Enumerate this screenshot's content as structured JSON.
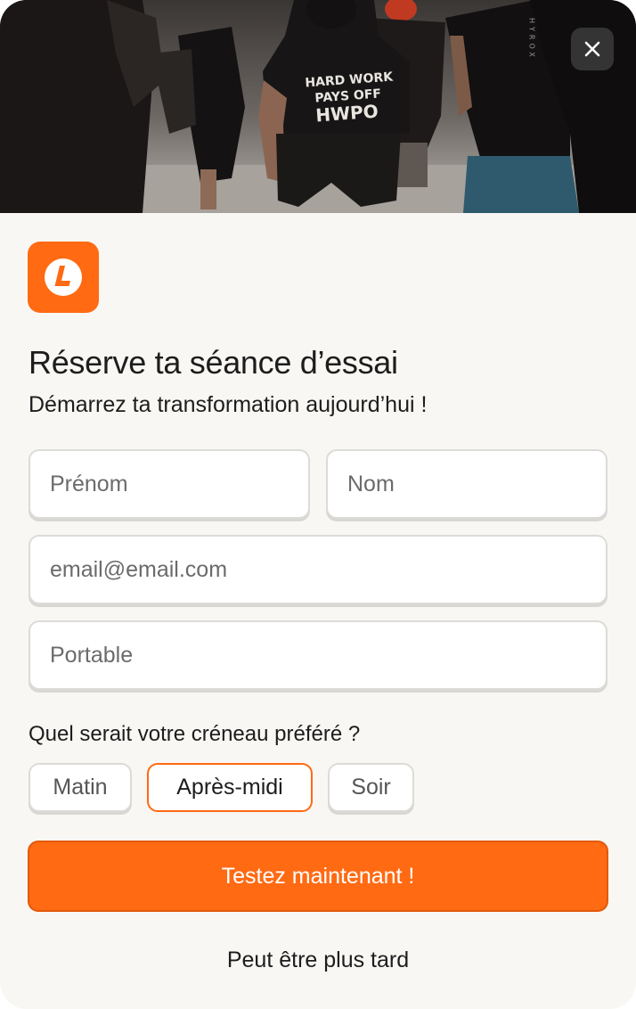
{
  "hero": {
    "photo_icon": "runners-photo",
    "shirt_text": [
      "HARD WORK",
      "PAYS OFF",
      "HWPO"
    ],
    "banner_text": "HYROX"
  },
  "close": {
    "icon": "close-icon"
  },
  "logo": {
    "icon": "brand-logo-icon",
    "color": "#ff6a13"
  },
  "title": "Réserve ta séance d’essai",
  "subtitle": "Démarrez ta transformation aujourd’hui !",
  "form": {
    "first_name": {
      "placeholder": "Prénom",
      "value": ""
    },
    "last_name": {
      "placeholder": "Nom",
      "value": ""
    },
    "email": {
      "placeholder": "email@email.com",
      "value": ""
    },
    "phone": {
      "placeholder": "Portable",
      "value": ""
    }
  },
  "slot": {
    "question": "Quel serait votre créneau préféré ?",
    "options": [
      "Matin",
      "Après-midi",
      "Soir"
    ],
    "selected": "Après-midi"
  },
  "cta_label": "Testez maintenant !",
  "later_label": "Peut être plus tard",
  "colors": {
    "accent": "#ff6a13",
    "background": "#f8f7f4"
  }
}
